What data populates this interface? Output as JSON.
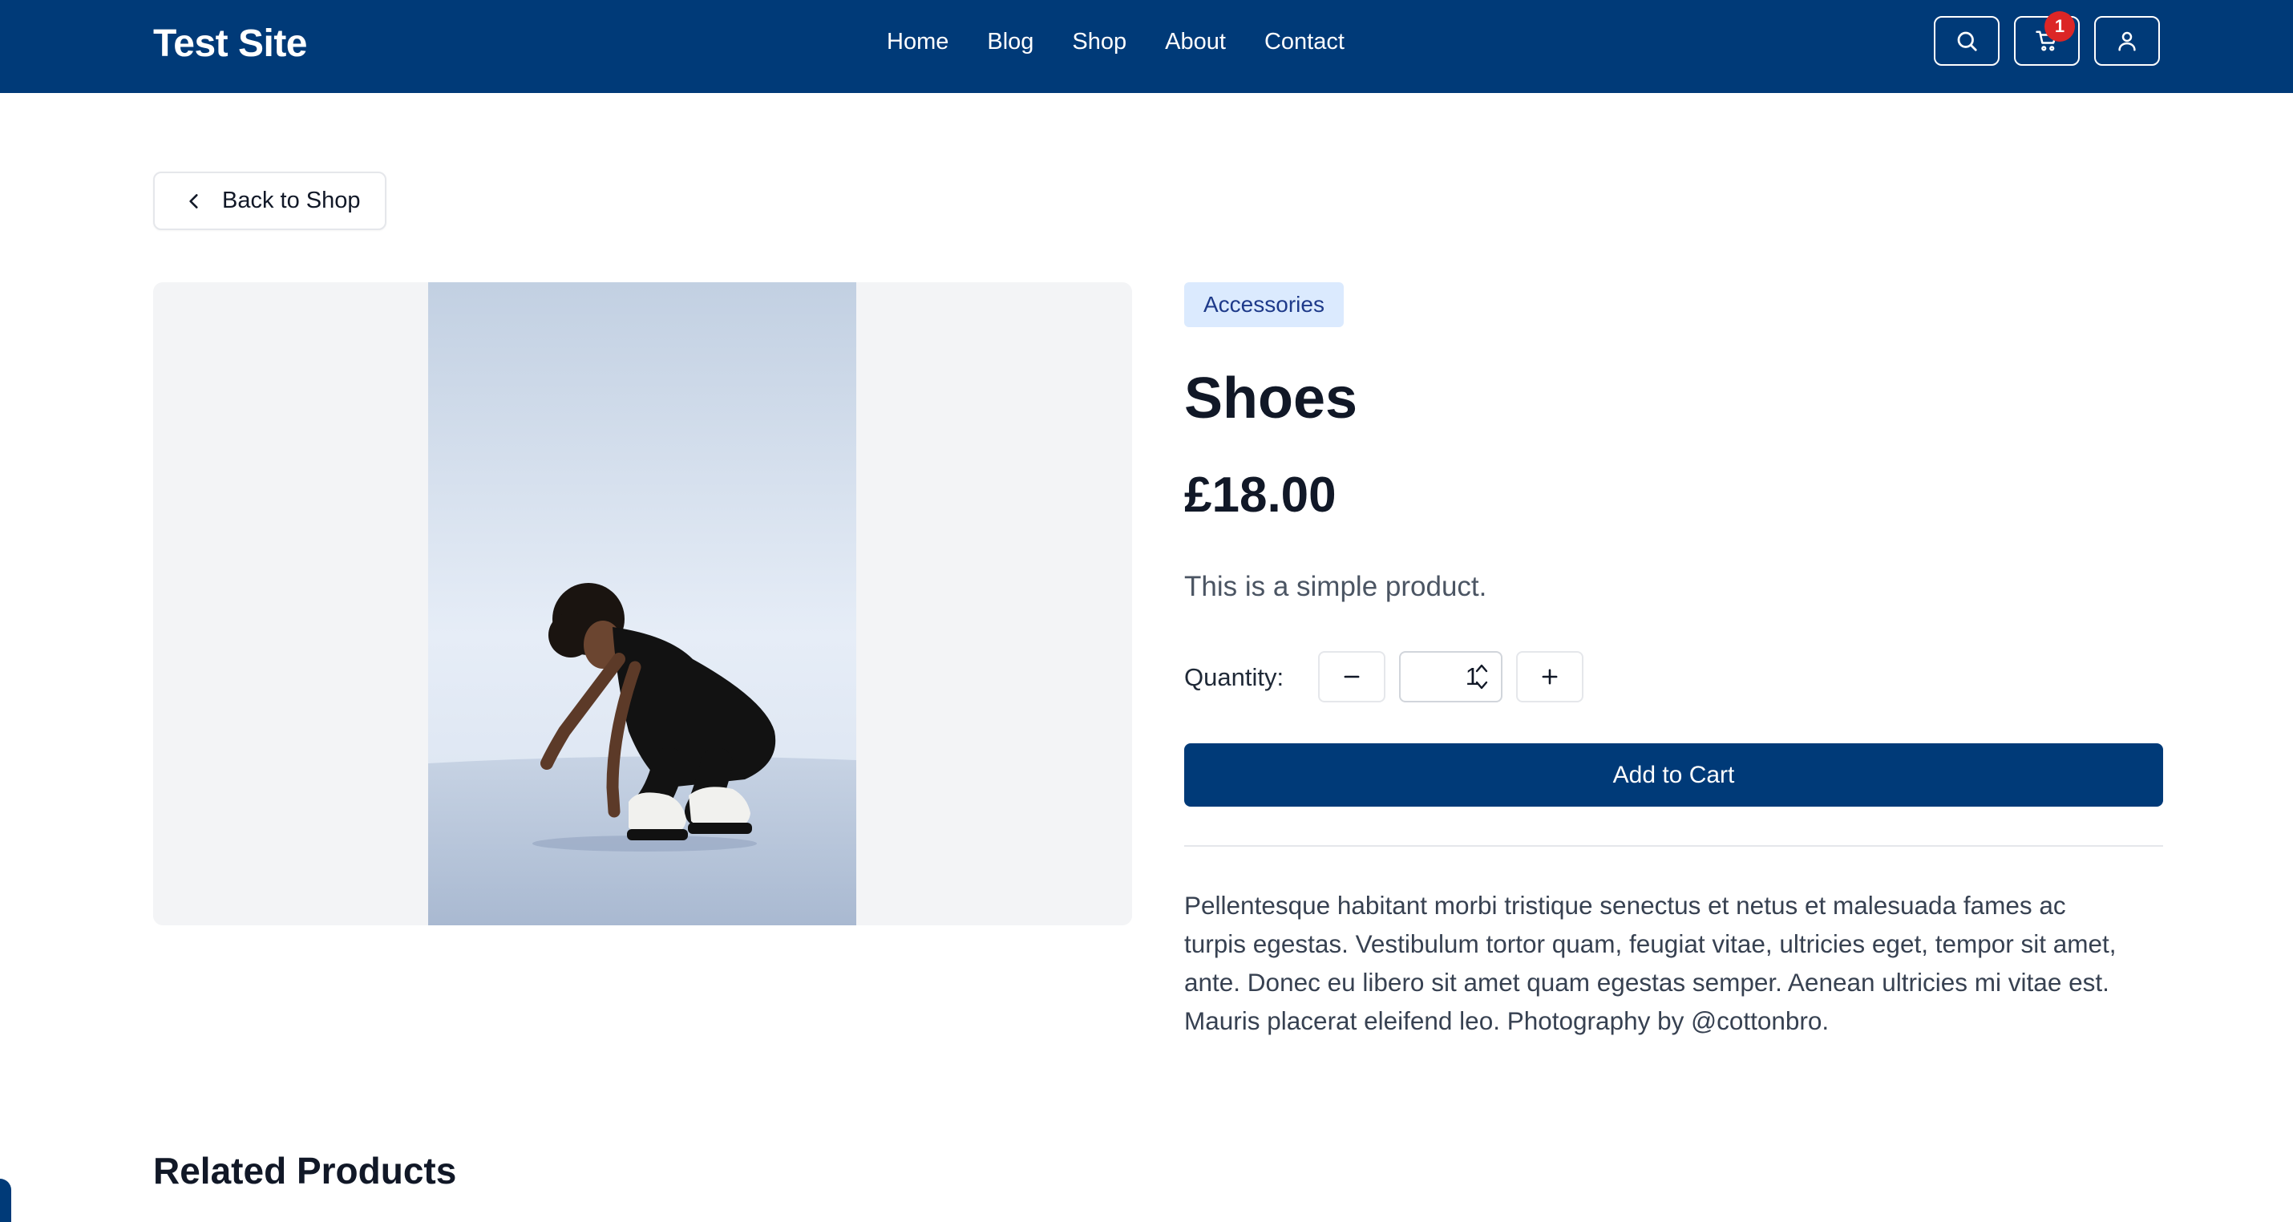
{
  "header": {
    "site_title": "Test Site",
    "nav": [
      "Home",
      "Blog",
      "Shop",
      "About",
      "Contact"
    ],
    "cart_count": "1",
    "bg_color": "#003a78",
    "icons": [
      "search-icon",
      "cart-icon",
      "user-icon"
    ]
  },
  "back_button": {
    "label": "Back to Shop"
  },
  "product": {
    "category": "Accessories",
    "title": "Shoes",
    "price": "£18.00",
    "short_description": "This is a simple product.",
    "quantity_label": "Quantity:",
    "quantity_value": "1",
    "add_to_cart_label": "Add to Cart",
    "long_description": "Pellentesque habitant morbi tristique senectus et netus et malesuada fames ac turpis egestas. Vestibulum tortor quam, feugiat vitae, ultricies eget, tempor sit amet, ante. Donec eu libero sit amet quam egestas semper. Aenean ultricies mi vitae est. Mauris placerat eleifend leo. Photography by @cottonbro."
  },
  "related": {
    "title": "Related Products"
  },
  "colors": {
    "primary": "#003a78",
    "badge": "#dc2626",
    "tag_bg": "#dbeafe",
    "tag_text": "#1e3a8a"
  }
}
